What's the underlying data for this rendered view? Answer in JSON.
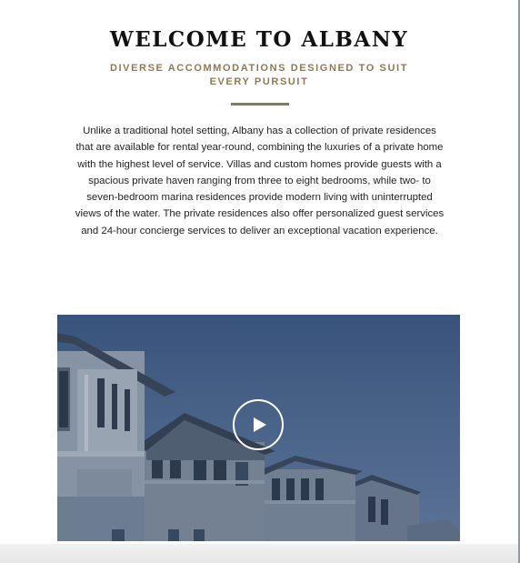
{
  "welcome": {
    "title": "WELCOME TO ALBANY",
    "subtitle": "DIVERSE ACCOMMODATIONS DESIGNED TO SUIT EVERY PURSUIT",
    "body_lines": [
      "Unlike a traditional hotel setting, Albany has a collection of private residences",
      "that are available for rental year-round, combining the luxuries of a private home",
      "with the highest level of service. Villas and custom homes provide guests with a",
      "spacious private haven ranging from three to eight bedrooms, while two- to",
      "seven-bedroom marina residences provide modern living with uninterrupted",
      "views of the water. The private residences also offer personalized guest services",
      "and 24-hour concierge services to deliver an exceptional vacation experience."
    ]
  },
  "video": {
    "play_icon": "play-icon",
    "overlay_color": "#2e4466"
  },
  "colors": {
    "accent": "#8e7a52",
    "heading": "#111111",
    "text": "#222222"
  }
}
